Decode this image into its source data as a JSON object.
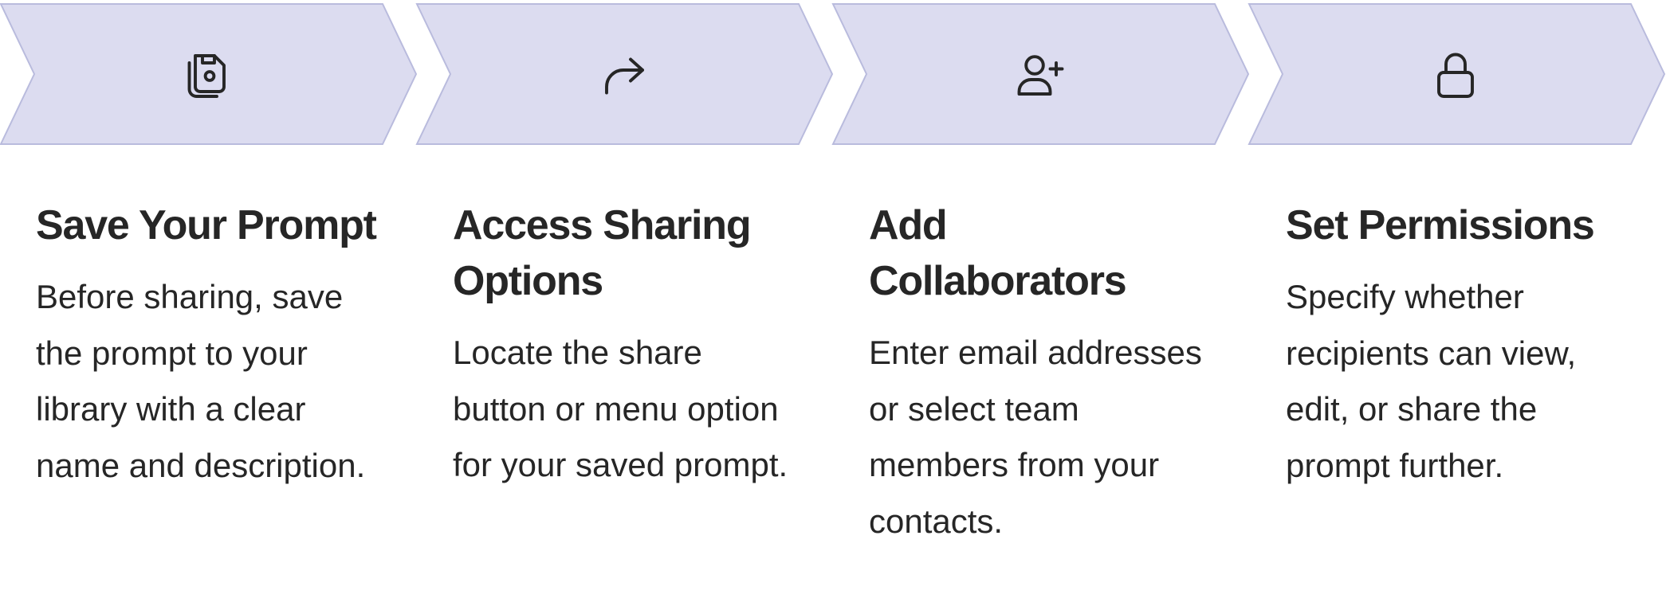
{
  "steps": [
    {
      "icon": "floppy-disk-save-icon",
      "title": "Save Your Prompt",
      "description": "Before sharing, save the prompt to your library with a clear name and description."
    },
    {
      "icon": "share-arrow-icon",
      "title": "Access Sharing Options",
      "description": "Locate the share button or menu option for your saved prompt."
    },
    {
      "icon": "user-plus-icon",
      "title": "Add Collaborators",
      "description": "Enter email addresses or select team members from your contacts."
    },
    {
      "icon": "lock-icon",
      "title": "Set Permissions",
      "description": "Specify whether recipients can view, edit, or share the prompt further."
    }
  ],
  "colors": {
    "chevron_fill": "#dcdcf0",
    "chevron_stroke": "#b9bbdd",
    "icon_stroke": "#262626",
    "text": "#262626"
  }
}
